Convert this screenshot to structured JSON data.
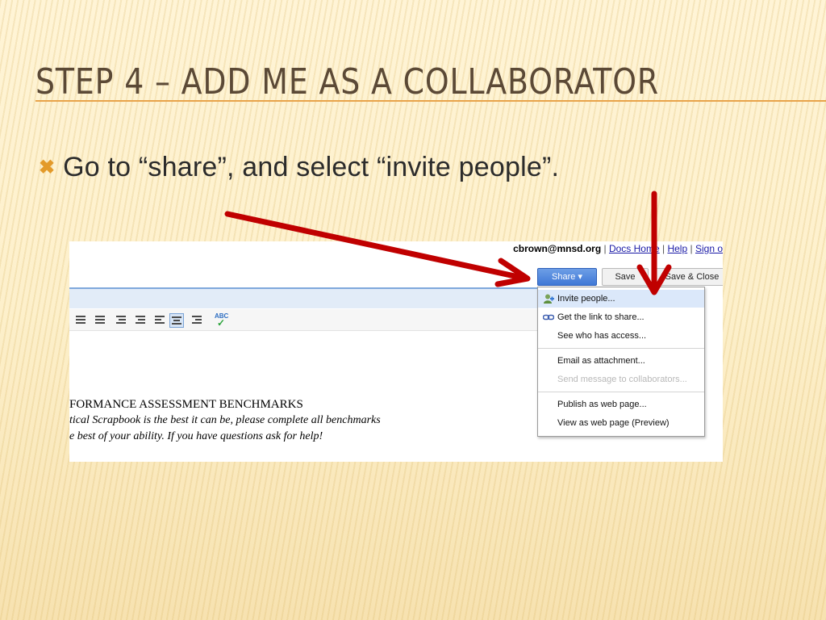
{
  "slide": {
    "title": "Step 4 – Add me as a collaborator",
    "bullet_icon": "x-bullet-icon",
    "bullet_text": "Go to “share”, and select “invite people”.",
    "accent_color": "#e39a2a",
    "title_color": "#5b4936",
    "arrow_color": "#c00000"
  },
  "docs": {
    "account_email": "cbrown@mnsd.org",
    "separator": "|",
    "links": [
      "Docs Home",
      "Help",
      "Sign o"
    ],
    "share_button": "Share ▾",
    "save_button": "Save",
    "save_close_button": "Save & Close",
    "share_menu": {
      "items": [
        {
          "label": "Invite people...",
          "icon": "invite-people-icon",
          "highlighted": true
        },
        {
          "label": "Get the link to share...",
          "icon": "link-icon"
        },
        {
          "label": "See who has access..."
        },
        {
          "label": "Email as attachment..."
        },
        {
          "label": "Send message to collaborators...",
          "disabled": true
        },
        {
          "label": "Publish as web page..."
        },
        {
          "label": "View as web page (Preview)"
        }
      ]
    },
    "document": {
      "heading": "FORMANCE ASSESSMENT BENCHMARKS",
      "lines": [
        "tical Scrapbook is the best it can be, please complete all benchmarks",
        "e best of your ability.  If you have questions ask for help!"
      ]
    }
  }
}
